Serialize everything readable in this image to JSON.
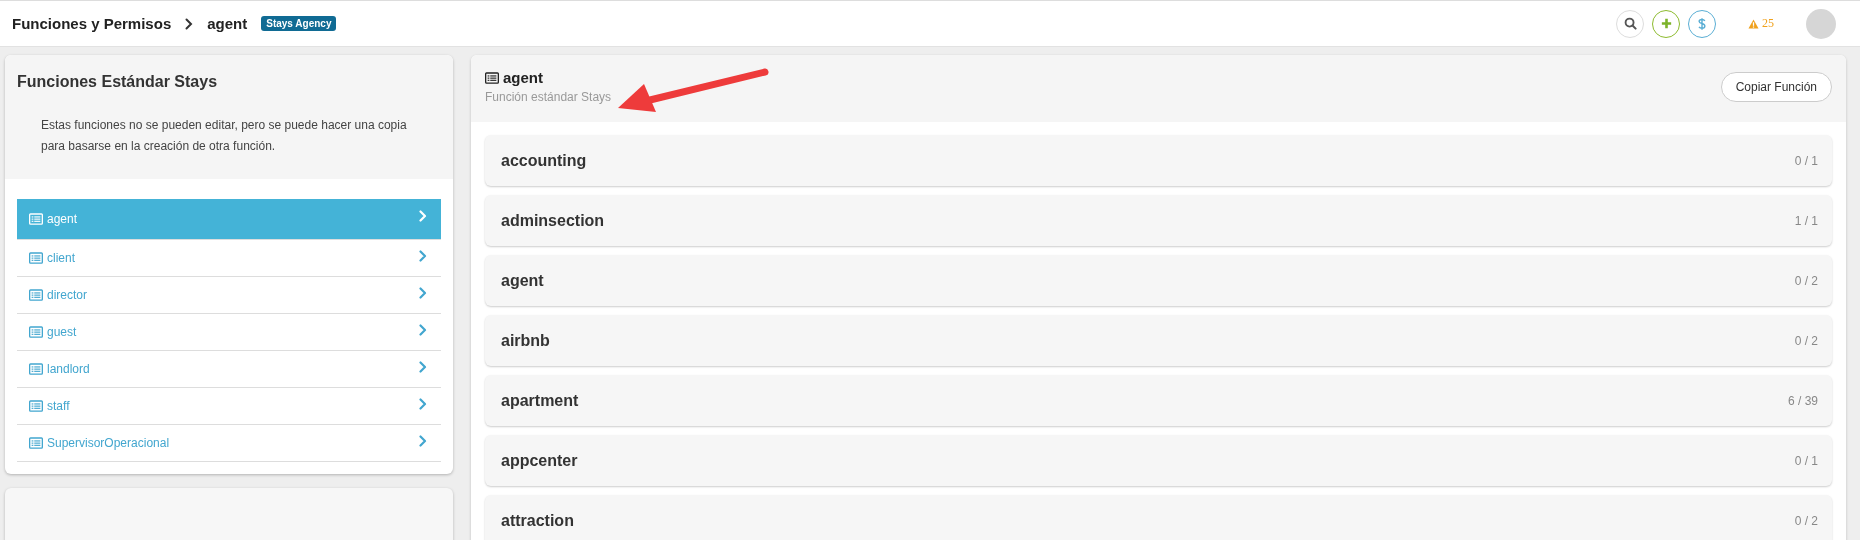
{
  "header": {
    "breadcrumb": [
      "Funciones y Permisos",
      "agent"
    ],
    "badge": "Stays Agency",
    "alert_count": "25"
  },
  "sidebar": {
    "title": "Funciones Estándar Stays",
    "description": "Estas funciones no se pueden editar, pero se puede hacer una copia para basarse en la creación de otra función.",
    "items": [
      {
        "label": "agent",
        "selected": true
      },
      {
        "label": "client",
        "selected": false
      },
      {
        "label": "director",
        "selected": false
      },
      {
        "label": "guest",
        "selected": false
      },
      {
        "label": "landlord",
        "selected": false
      },
      {
        "label": "staff",
        "selected": false
      },
      {
        "label": "SupervisorOperacional",
        "selected": false
      }
    ]
  },
  "detail": {
    "title": "agent",
    "subtitle": "Función estándar Stays",
    "copy_button": "Copiar Función",
    "sections": [
      {
        "name": "accounting",
        "count": "0 / 1"
      },
      {
        "name": "adminsection",
        "count": "1 / 1"
      },
      {
        "name": "agent",
        "count": "0 / 2"
      },
      {
        "name": "airbnb",
        "count": "0 / 2"
      },
      {
        "name": "apartment",
        "count": "6 / 39"
      },
      {
        "name": "appcenter",
        "count": "0 / 1"
      },
      {
        "name": "attraction",
        "count": "0 / 2"
      }
    ]
  }
}
